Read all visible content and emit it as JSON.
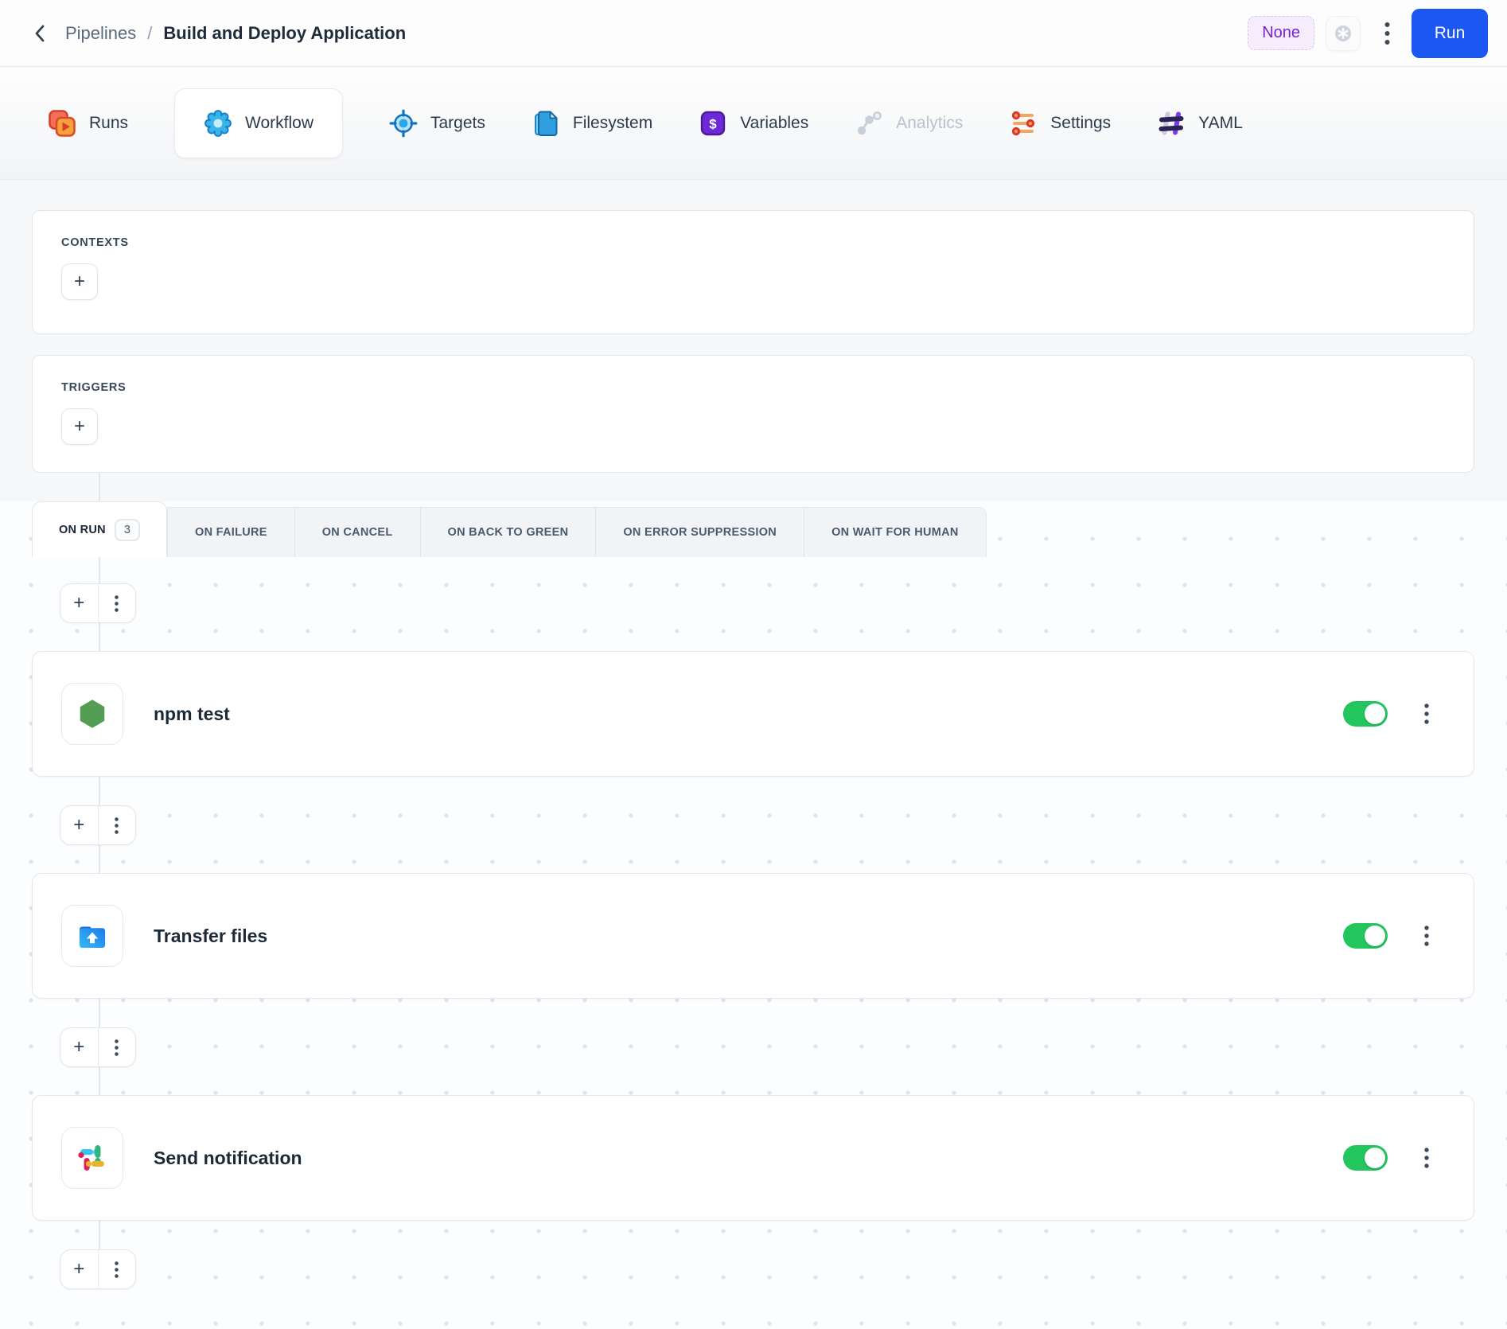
{
  "header": {
    "breadcrumb": {
      "parent": "Pipelines",
      "separator": "/",
      "current": "Build and Deploy Application"
    },
    "target_badge": "None",
    "run_label": "Run"
  },
  "nav_tabs": [
    {
      "label": "Runs",
      "icon": "runs-icon",
      "active": false,
      "disabled": false
    },
    {
      "label": "Workflow",
      "icon": "workflow-icon",
      "active": true,
      "disabled": false
    },
    {
      "label": "Targets",
      "icon": "targets-icon",
      "active": false,
      "disabled": false
    },
    {
      "label": "Filesystem",
      "icon": "filesystem-icon",
      "active": false,
      "disabled": false
    },
    {
      "label": "Variables",
      "icon": "variables-icon",
      "active": false,
      "disabled": false
    },
    {
      "label": "Analytics",
      "icon": "analytics-icon",
      "active": false,
      "disabled": true
    },
    {
      "label": "Settings",
      "icon": "settings-icon",
      "active": false,
      "disabled": false
    },
    {
      "label": "YAML",
      "icon": "yaml-icon",
      "active": false,
      "disabled": false
    }
  ],
  "sections": {
    "contexts": {
      "title": "CONTEXTS"
    },
    "triggers": {
      "title": "TRIGGERS"
    },
    "add_button": "+"
  },
  "event_tabs": [
    {
      "label": "ON RUN",
      "count": "3",
      "active": true
    },
    {
      "label": "ON FAILURE",
      "active": false
    },
    {
      "label": "ON CANCEL",
      "active": false
    },
    {
      "label": "ON BACK TO GREEN",
      "active": false
    },
    {
      "label": "ON ERROR SUPPRESSION",
      "active": false
    },
    {
      "label": "ON WAIT FOR HUMAN",
      "active": false
    }
  ],
  "actions": [
    {
      "name": "npm test",
      "icon": "nodejs-icon",
      "enabled": true
    },
    {
      "name": "Transfer files",
      "icon": "upload-folder-icon",
      "enabled": true
    },
    {
      "name": "Send notification",
      "icon": "slack-icon",
      "enabled": true
    }
  ],
  "colors": {
    "run_button_blue": "#1b57f0",
    "toggle_green": "#22c55e",
    "badge_purple_bg": "#f5edfc",
    "badge_purple_text": "#7a1fd6",
    "canvas_dot": "#dfe3e9",
    "card_border": "#e4e7eb"
  }
}
